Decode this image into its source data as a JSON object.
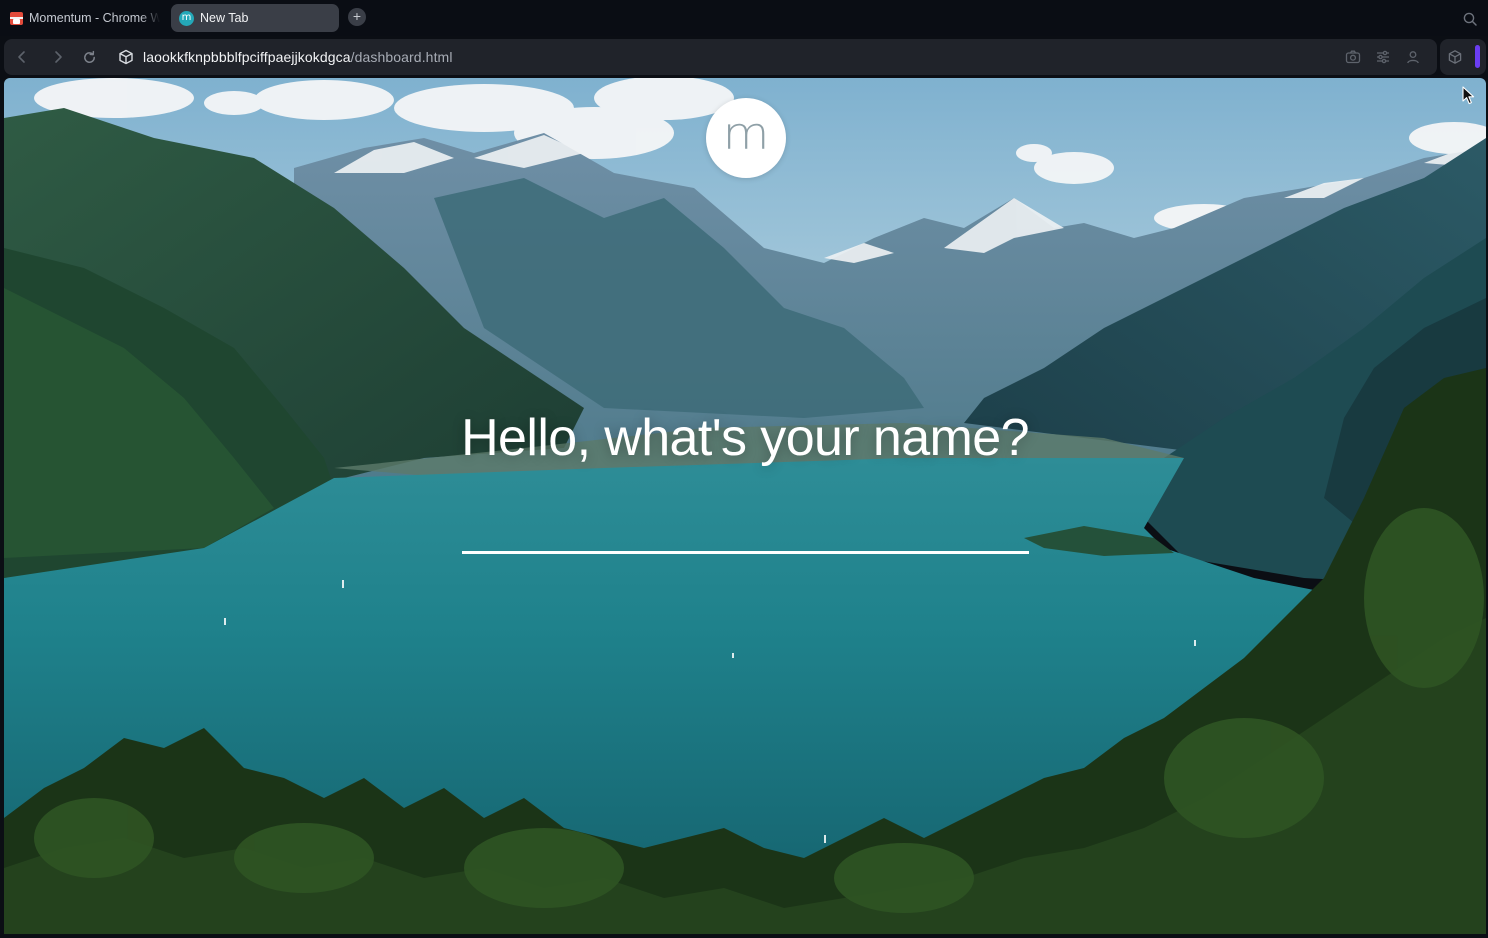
{
  "browser": {
    "tabs": [
      {
        "title": "Momentum - Chrome Web Store",
        "favicon": "store-icon",
        "active": false
      },
      {
        "title": "New Tab",
        "favicon": "momentum-icon",
        "active": true
      }
    ],
    "favicon_letter": "m",
    "new_tab_symbol": "+",
    "address": {
      "host": "laookkfknpbbblfpciffpaejjkokdgca",
      "path": "/dashboard.html"
    },
    "toolbar_icons": [
      "back-icon",
      "forward-icon",
      "reload-icon",
      "extension-icon",
      "camera-icon",
      "sliders-icon",
      "profile-icon",
      "cube-icon"
    ],
    "accent_color": "#6a3df2"
  },
  "page": {
    "logo_letter": "m",
    "greeting": "Hello, what's your name?",
    "name_input": {
      "value": "",
      "placeholder": ""
    }
  }
}
